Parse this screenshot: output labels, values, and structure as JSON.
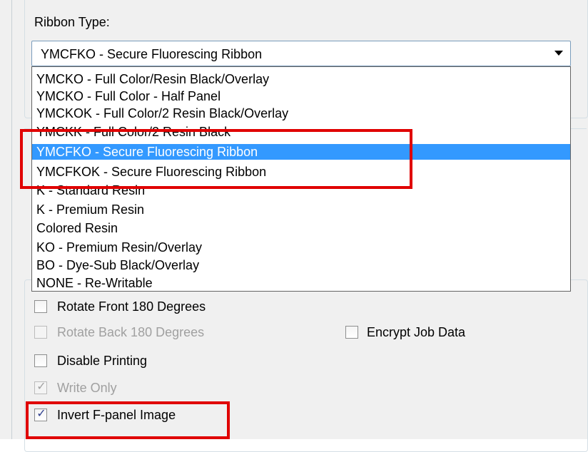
{
  "ribbon": {
    "label": "Ribbon Type:",
    "selected": "YMCFKO - Secure Fluorescing Ribbon",
    "options": [
      "YMCKO - Full Color/Resin Black/Overlay",
      "YMCKO - Full Color - Half Panel",
      "YMCKOK - Full Color/2 Resin Black/Overlay",
      "YMCKK - Full Color/2 Resin Black",
      "YMCFKO - Secure Fluorescing Ribbon",
      "YMCFKOK - Secure Fluorescing Ribbon",
      "K - Standard Resin",
      "K - Premium Resin",
      "Colored Resin",
      "KO - Premium Resin/Overlay",
      "BO - Dye-Sub Black/Overlay",
      "NONE - Re-Writable"
    ],
    "highlight_color": "#3399ff"
  },
  "options": {
    "rotate_front": {
      "label": "Rotate Front 180 Degrees",
      "checked": false,
      "enabled": true
    },
    "rotate_back": {
      "label": "Rotate Back 180 Degrees",
      "checked": false,
      "enabled": false
    },
    "encrypt": {
      "label": "Encrypt Job Data",
      "checked": false,
      "enabled": true
    },
    "disable_printing": {
      "label": "Disable Printing",
      "checked": false,
      "enabled": true
    },
    "write_only": {
      "label": "Write Only",
      "checked": true,
      "enabled": false
    },
    "invert_fpanel": {
      "label": "Invert F-panel Image",
      "checked": true,
      "enabled": true
    }
  },
  "annotation_color": "#e00000",
  "check_glyph": "✓"
}
